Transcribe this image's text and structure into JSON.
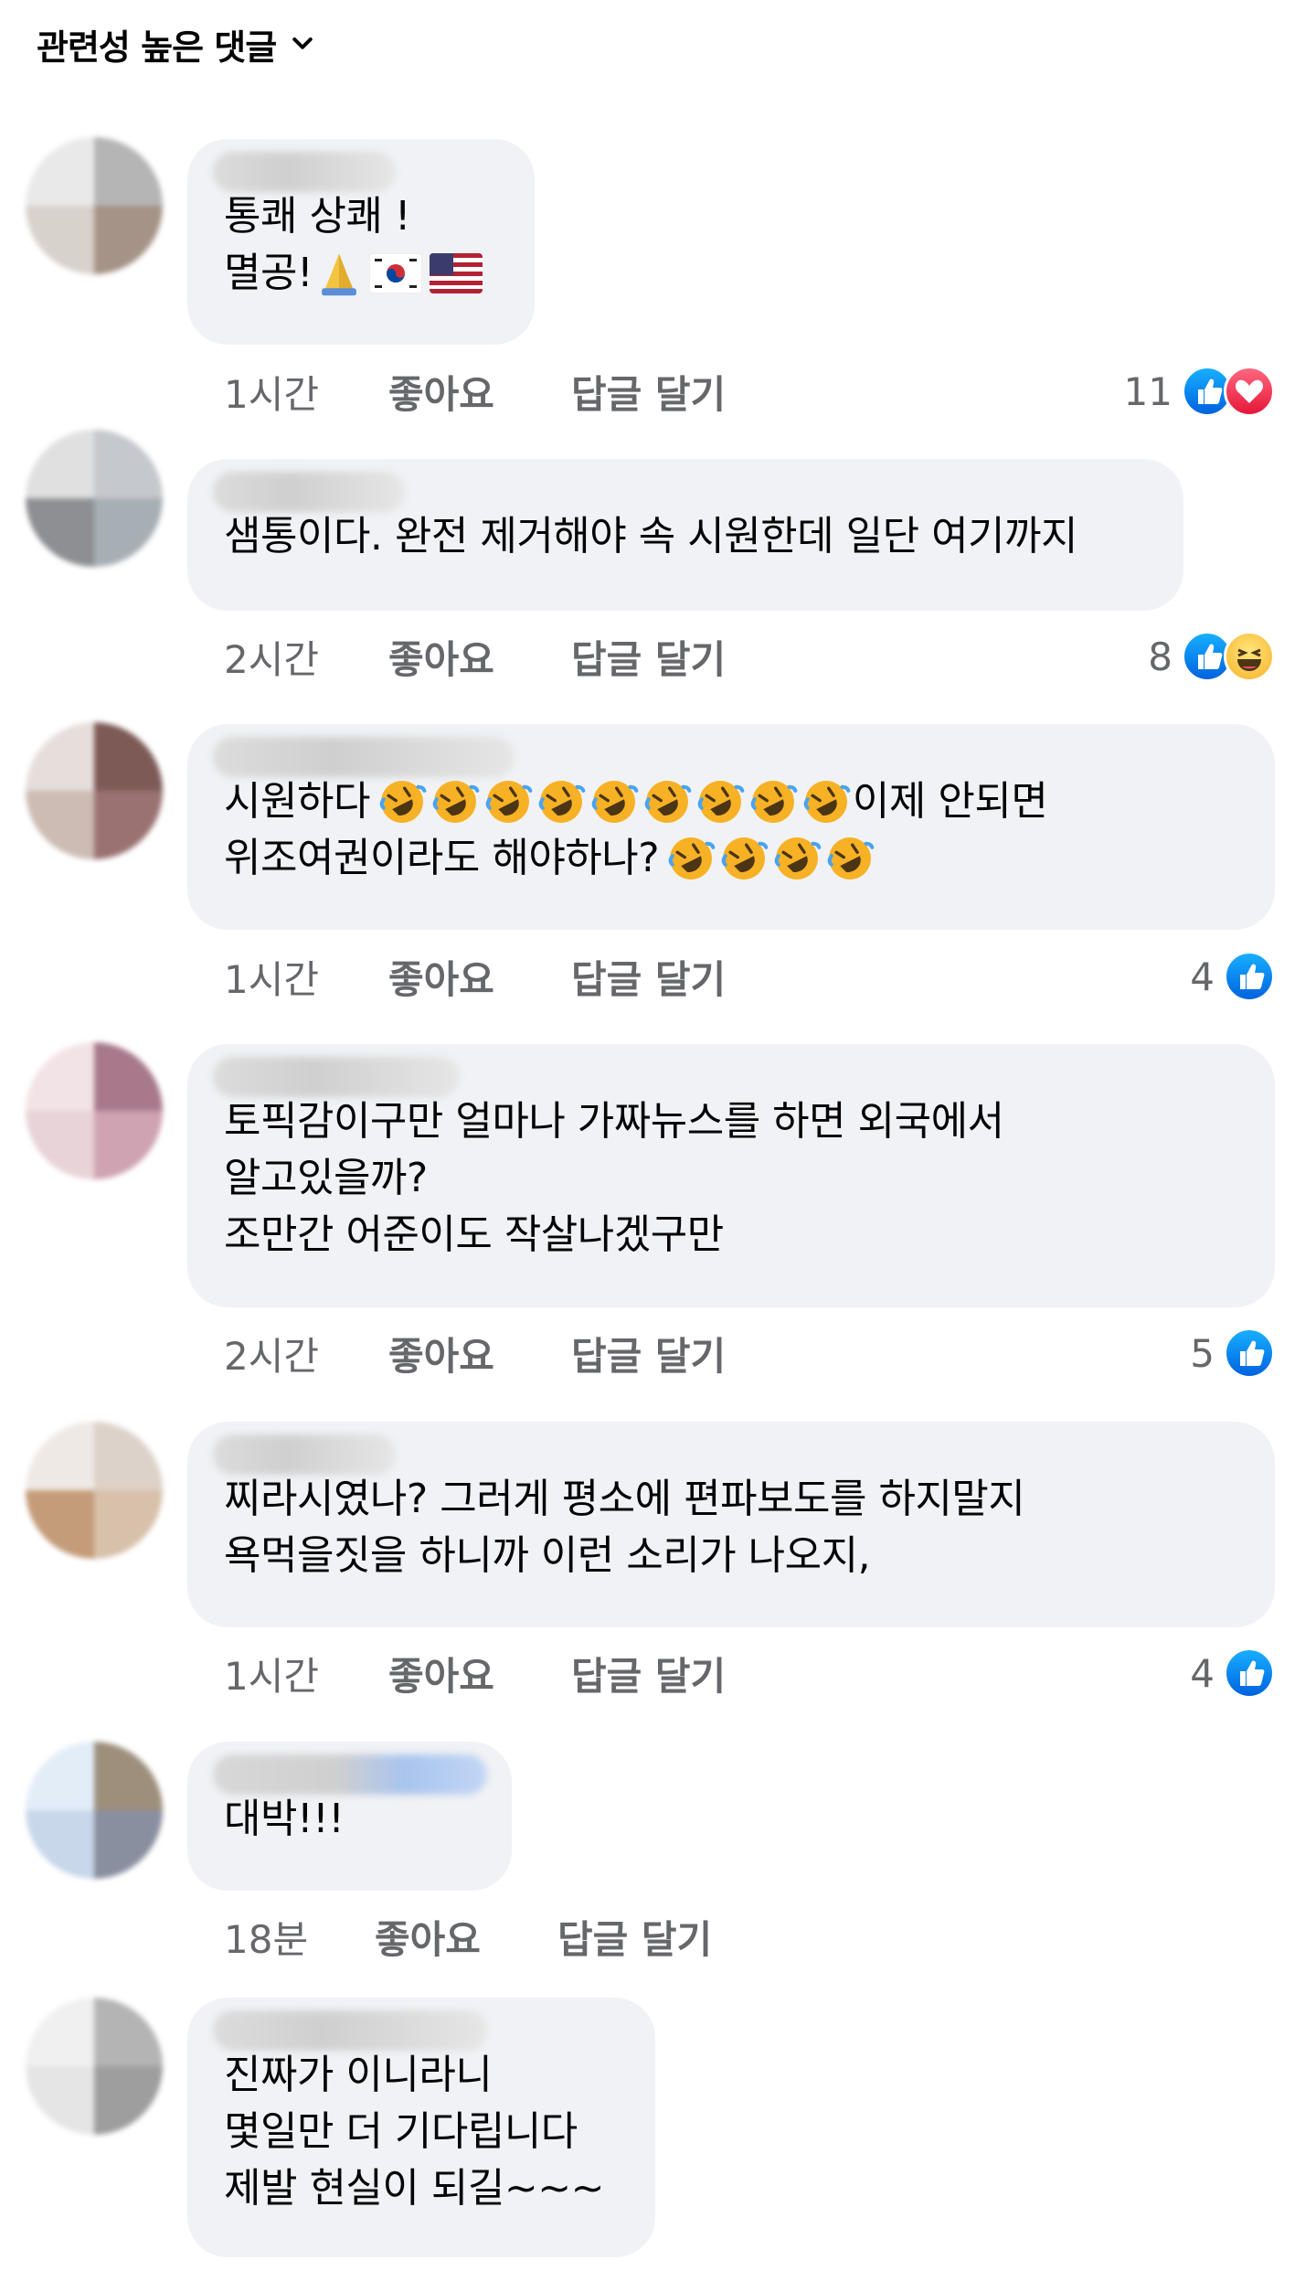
{
  "header": {
    "sort_label": "관련성 높은 댓글"
  },
  "comments": [
    {
      "lines": [
        "통쾌 상쾌 !",
        "멸공!"
      ],
      "time": "1시간",
      "like": "좋아요",
      "reply": "답글 달기",
      "reaction_count": "11",
      "reactions": [
        "like-icon",
        "heart-icon"
      ]
    },
    {
      "lines": [
        "샘통이다. 완전 제거해야 속 시원한데 일단 여기까지"
      ],
      "time": "2시간",
      "like": "좋아요",
      "reply": "답글 달기",
      "reaction_count": "8",
      "reactions": [
        "like-icon",
        "haha-icon"
      ]
    },
    {
      "lines": [
        "시원하다",
        "이제 안되면",
        "위조여권이라도 해야하나?"
      ],
      "time": "1시간",
      "like": "좋아요",
      "reply": "답글 달기",
      "reaction_count": "4",
      "reactions": [
        "like-icon"
      ]
    },
    {
      "lines": [
        "토픽감이구만 얼마나 가짜뉴스를 하면 외국에서",
        "알고있을까?",
        "조만간 어준이도 작살나겠구만"
      ],
      "time": "2시간",
      "like": "좋아요",
      "reply": "답글 달기",
      "reaction_count": "5",
      "reactions": [
        "like-icon"
      ]
    },
    {
      "lines": [
        "찌라시였나?  그러게 평소에 편파보도를 하지말지",
        "욕먹을짓을 하니까 이런 소리가 나오지,"
      ],
      "time": "1시간",
      "like": "좋아요",
      "reply": "답글 달기",
      "reaction_count": "4",
      "reactions": [
        "like-icon"
      ]
    },
    {
      "lines": [
        "대박!!!"
      ],
      "time": "18분",
      "like": "좋아요",
      "reply": "답글 달기"
    },
    {
      "lines": [
        "진짜가 이니라니",
        "몇일만 더 기다립니다",
        "제발 현실이 되길~~~"
      ]
    }
  ]
}
